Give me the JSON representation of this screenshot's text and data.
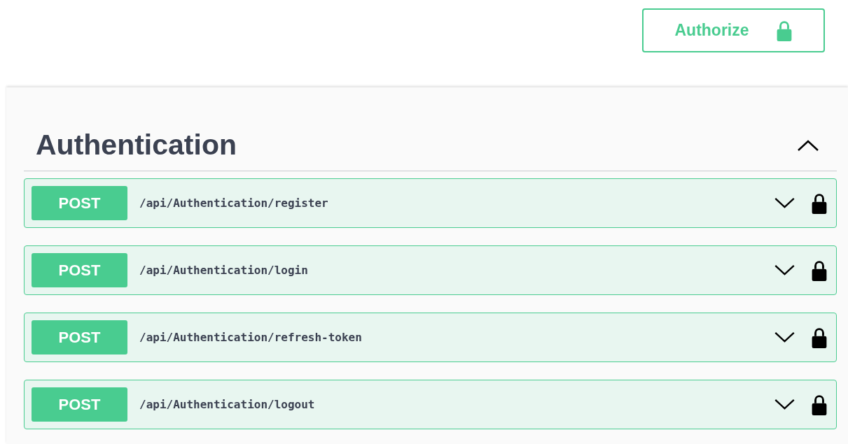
{
  "authorize_button": {
    "label": "Authorize",
    "locked": true
  },
  "section": {
    "title": "Authentication",
    "expanded": true,
    "operations": [
      {
        "method": "POST",
        "path": "/api/Authentication/register",
        "expanded": false,
        "locked": true
      },
      {
        "method": "POST",
        "path": "/api/Authentication/login",
        "expanded": false,
        "locked": true
      },
      {
        "method": "POST",
        "path": "/api/Authentication/refresh-token",
        "expanded": false,
        "locked": true
      },
      {
        "method": "POST",
        "path": "/api/Authentication/logout",
        "expanded": false,
        "locked": true
      }
    ]
  }
}
